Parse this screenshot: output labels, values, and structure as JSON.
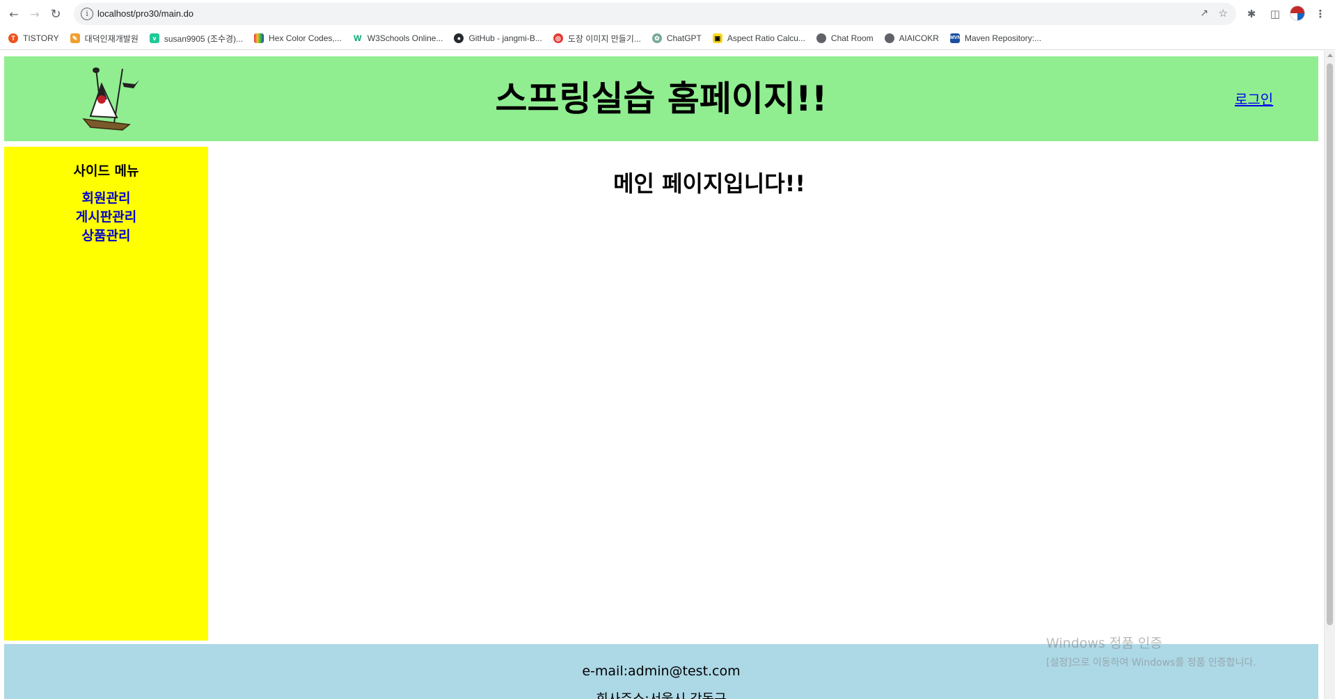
{
  "browser": {
    "url": "localhost/pro30/main.do",
    "bookmarks": [
      {
        "label": "TISTORY",
        "icon": "tistory-icon",
        "color": "#eb531f"
      },
      {
        "label": "대덕인재개발원",
        "icon": "brush-icon",
        "color": "#f0a030"
      },
      {
        "label": "susan9905 (조수경)...",
        "icon": "velog-icon",
        "color": "#20c997"
      },
      {
        "label": "Hex Color Codes,...",
        "icon": "color-palette-icon",
        "color": "#d33"
      },
      {
        "label": "W3Schools Online...",
        "icon": "w3schools-icon",
        "color": "#04aa6d"
      },
      {
        "label": "GitHub - jangmi-B...",
        "icon": "github-icon",
        "color": "#24292f"
      },
      {
        "label": "도장 이미지 만들기...",
        "icon": "stamp-icon",
        "color": "#e53935"
      },
      {
        "label": "ChatGPT",
        "icon": "chatgpt-icon",
        "color": "#74aa9c"
      },
      {
        "label": "Aspect Ratio Calcu...",
        "icon": "aspect-ratio-icon",
        "color": "#f9d71c"
      },
      {
        "label": "Chat Room",
        "icon": "globe-icon",
        "color": "#5f6368"
      },
      {
        "label": "AIAICOKR",
        "icon": "globe-icon",
        "color": "#5f6368"
      },
      {
        "label": "Maven Repository:...",
        "icon": "maven-icon",
        "color": "#1a4fa0"
      }
    ]
  },
  "header": {
    "title": "스프링실습 홈페이지!!",
    "login_label": "로그인",
    "logo_icon": "java-duke-logo-icon",
    "bg_color": "#90ee90"
  },
  "sidebar": {
    "title": "사이드 메뉴",
    "items": [
      {
        "label": "회원관리"
      },
      {
        "label": "게시판관리"
      },
      {
        "label": "상품관리"
      }
    ],
    "bg_color": "#ffff00"
  },
  "main": {
    "heading": "메인 페이지입니다!!"
  },
  "footer": {
    "email": "e-mail:admin@test.com",
    "address": "회사주소:서울시 강동구",
    "bg_color": "#add8e6"
  },
  "watermark": {
    "line1": "Windows 정품 인증",
    "line2": "[설정]으로 이동하여 Windows를 정품 인증합니다."
  }
}
